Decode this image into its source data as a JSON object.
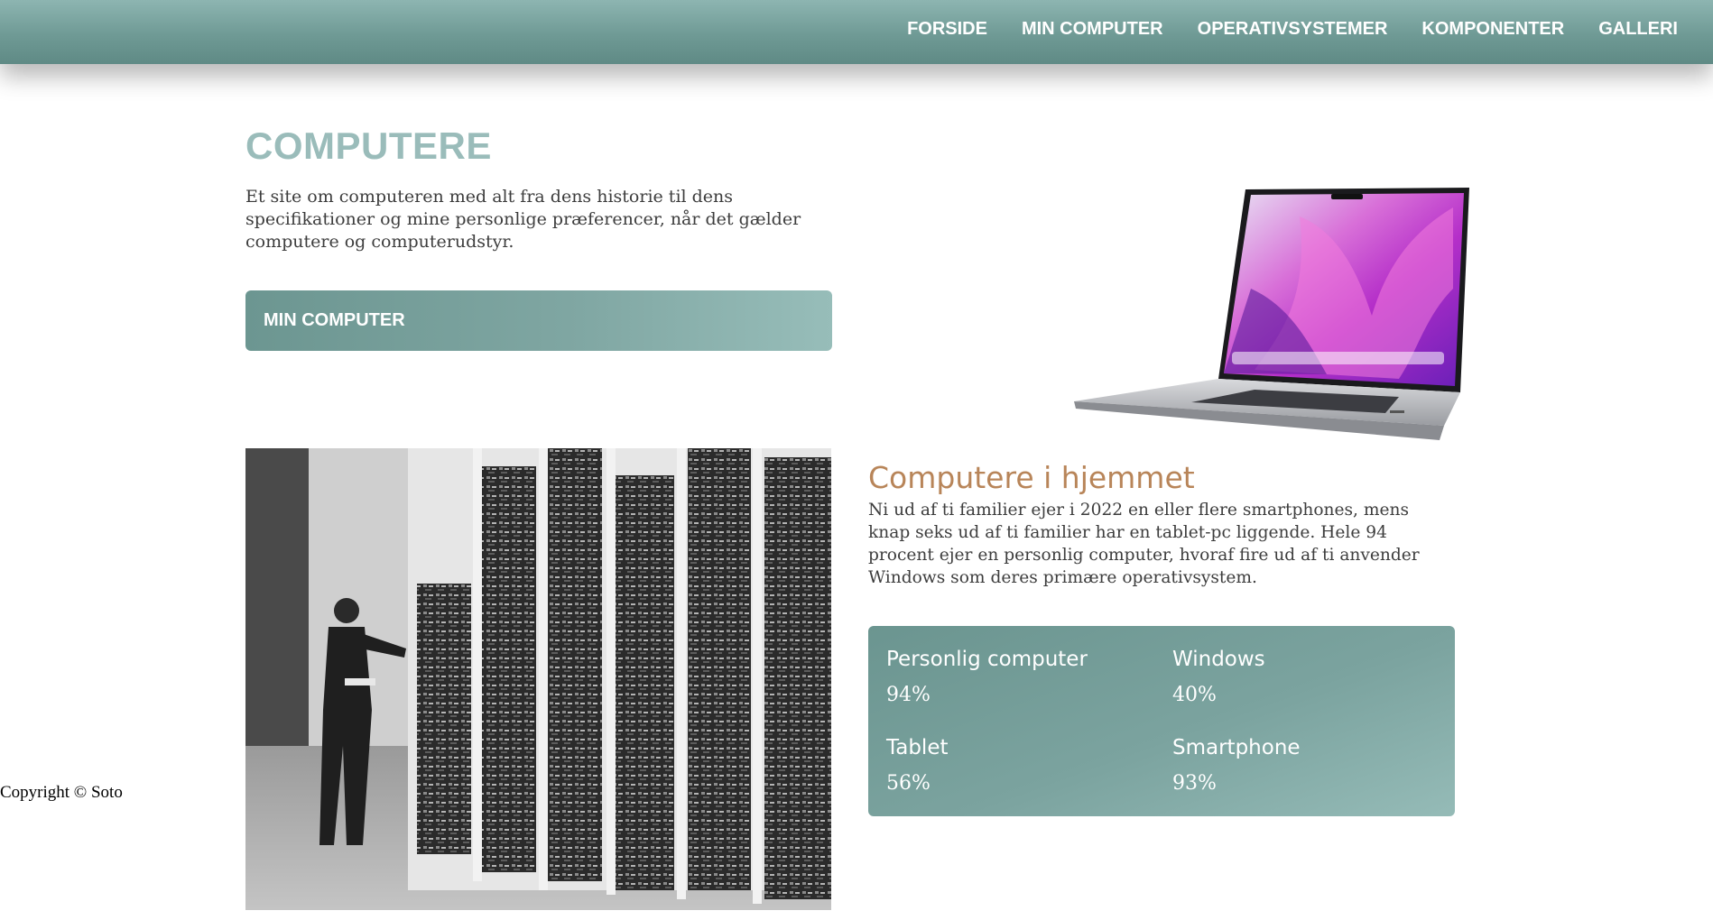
{
  "nav": {
    "items": [
      {
        "label": "FORSIDE"
      },
      {
        "label": "MIN COMPUTER"
      },
      {
        "label": "OPERATIVSYSTEMER"
      },
      {
        "label": "KOMPONENTER"
      },
      {
        "label": "GALLERI"
      }
    ]
  },
  "hero": {
    "title": "COMPUTERE",
    "intro": "Et site om computeren med alt fra dens historie til dens specifikationer og mine personlige præferencer, når det gælder computere og computerudstyr.",
    "button_label": "MIN COMPUTER"
  },
  "images": {
    "laptop": "laptop-image",
    "mainframe": "mainframe-photo"
  },
  "section": {
    "title": "Computere i hjemmet",
    "text": "Ni ud af ti familier ejer i 2022 en eller flere smartphones, mens knap seks ud af ti familier har en tablet-pc liggende. Hele 94 procent ejer en personlig computer, hvoraf fire ud af ti anvender Windows som deres primære operativsystem."
  },
  "stats": [
    {
      "label": "Personlig computer",
      "value": "94%"
    },
    {
      "label": "Windows",
      "value": "40%"
    },
    {
      "label": "Tablet",
      "value": "56%"
    },
    {
      "label": "Smartphone",
      "value": "93%"
    }
  ],
  "footer": {
    "copyright": "Copyright © Soto"
  },
  "colors": {
    "header": "#7aa39f",
    "title": "#9abcba",
    "section_title": "#b88559"
  }
}
